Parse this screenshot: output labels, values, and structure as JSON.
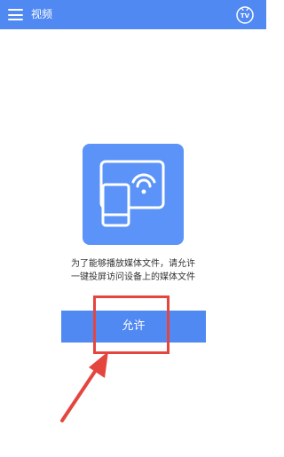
{
  "header": {
    "menu_icon": "hamburger-menu-icon",
    "title": "视频",
    "tv_icon": "tv-icon",
    "tv_icon_label": "TV"
  },
  "permission": {
    "illustration_icon": "screen-cast-icon",
    "message_line1": "为了能够播放媒体文件，请允许",
    "message_line2": "一键投屏访问设备上的媒体文件",
    "allow_label": "允许"
  },
  "annotation": {
    "highlight_color": "#e5453f",
    "arrow_icon": "pointer-arrow-icon"
  },
  "colors": {
    "primary": "#5189f3",
    "background": "#ffffff",
    "text": "#333333"
  }
}
